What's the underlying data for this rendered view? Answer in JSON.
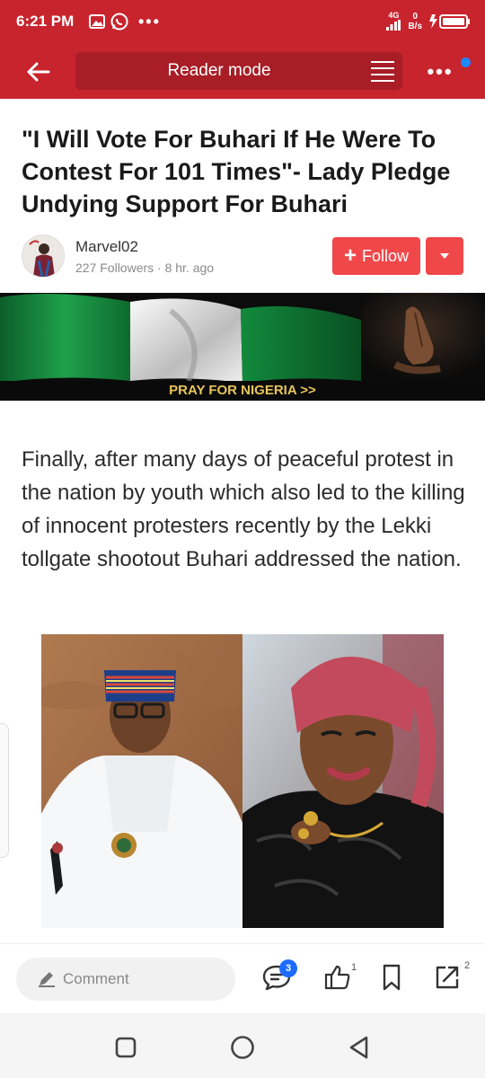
{
  "status_bar": {
    "time": "6:21 PM",
    "network": "4G",
    "speed_value": "0",
    "speed_unit": "B/s",
    "dots": "•••"
  },
  "app_bar": {
    "title": "Reader mode",
    "more": "•••"
  },
  "article": {
    "title": "\"I Will Vote For Buhari If He Were To Contest For 101 Times\"- Lady Pledge Undying Support For Buhari",
    "author": {
      "name": "Marvel02",
      "meta": "227 Followers · 8 hr. ago"
    },
    "follow_label": "Follow",
    "follow_plus": "+",
    "banner_caption": "PRAY FOR NIGERIA >>",
    "paragraph": "Finally, after many days of peaceful protest in the nation by youth which also led to the killing of innocent protesters recently by the Lekki tollgate shootout Buhari addressed the nation."
  },
  "action_bar": {
    "comment_placeholder": "Comment",
    "comments_badge": "3",
    "likes_count": "1",
    "shares_count": "2"
  },
  "colors": {
    "brand_red": "#c8242e",
    "follow_red": "#f0484a",
    "badge_blue": "#1e6bff",
    "banner_gold": "#e8c45a"
  },
  "icons": {
    "back": "arrow-left-icon",
    "reader": "reader-lines-icon",
    "comment_pen": "pencil-icon",
    "comments": "chat-bubble-icon",
    "like": "thumbs-up-icon",
    "bookmark": "bookmark-icon",
    "share": "share-arrow-icon",
    "nav_recents": "square-icon",
    "nav_home": "circle-icon",
    "nav_back": "triangle-back-icon"
  }
}
